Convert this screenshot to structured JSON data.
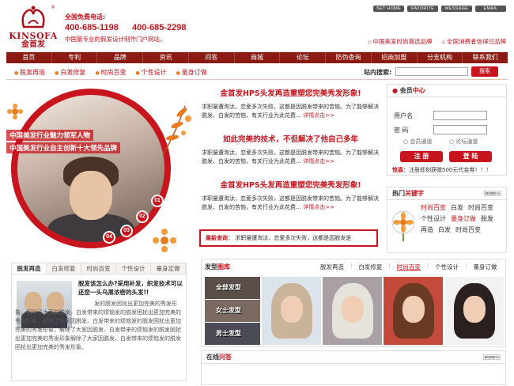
{
  "brand": {
    "name_en": "KINSOFA",
    "name_cn": "金首发",
    "reg_mark": "®"
  },
  "hotline": {
    "label": "全国免费电话:",
    "numbers": [
      "400-685-1198",
      "400-685-2298"
    ],
    "slogan": "中国最专业的假发设计制作门户网站。"
  },
  "top_buttons": [
    "SET HOME",
    "FAVORITE",
    "MESSAGE",
    "EMAIL"
  ],
  "top_links": [
    "中国美发时尚首选品牌",
    "全国消费者信得过品牌"
  ],
  "nav": [
    "首页",
    "专利",
    "品牌",
    "资讯",
    "问答",
    "商城",
    "论坛",
    "防伪查询",
    "招商加盟",
    "分支机构",
    "联系我们"
  ],
  "subnav": [
    "脱发再造",
    "白发修复",
    "时尚百变",
    "个性设计",
    "量身订做"
  ],
  "search": {
    "label": "站内搜索:",
    "button": "搜索"
  },
  "hero": {
    "slogans": [
      "中国美发行业魅力领军人物",
      "中国美发行业自主创新十大领先品牌"
    ],
    "dots": [
      "01",
      "02",
      "03",
      "04"
    ]
  },
  "news": [
    {
      "title": "金首发HPS头发再造重塑您完美秀发形象!",
      "text": "求职屡遭淘汰，恋爱多次失败，这都是因脱发带来的苦恼。为了能够解决脱发、白发的苦恼，有关行业为此花费…",
      "more": "详情点击>>"
    },
    {
      "title": "如此完美的技术，不但解决了他自己多年",
      "text": "求职屡遭淘汰，恋爱多次失败，这都是因脱发带来的苦恼。为了能够解决脱发、白发的苦恼，有关行业为此花费…",
      "more": "详情点击>>"
    },
    {
      "title": "金首发HPS头发再造重塑您完美秀发形象!",
      "text": "求职屡遭淘汰，恋爱多次失败，这都是因脱发带来的苦恼。为了能够解决脱发、白发的苦恼，有关行业为此花费…",
      "more": "详情点击>>"
    }
  ],
  "latest": {
    "label": "最新查询：",
    "text": "求职屡遭淘汰，恋爱多次失败，这都是因脱发是"
  },
  "member": {
    "title_a": "会员",
    "title_b": "中心",
    "username_label": "用户名",
    "password_label": "密  码",
    "radio1": "会员通道",
    "radio2": "论坛通道",
    "register": "注 册",
    "login": "登 陆",
    "notice_label": "惊喜：",
    "notice_text": "注册即刻获赠500元代金券！！！"
  },
  "keywords": {
    "title_a": "热门",
    "title_b": "关键字",
    "more": "MORE>>",
    "items": [
      {
        "t": "时尚百变",
        "red": true
      },
      {
        "t": "白发",
        "red": false
      },
      {
        "t": "时尚百变",
        "red": false
      },
      {
        "t": "个性设计",
        "red": false
      },
      {
        "t": "量身订做",
        "red": true
      },
      {
        "t": "脱发",
        "red": false
      },
      {
        "t": "再造",
        "red": false
      },
      {
        "t": "白发",
        "red": false
      },
      {
        "t": "时尚百变",
        "red": false
      }
    ]
  },
  "tabs": {
    "labels": [
      "脱发再造",
      "白发修复",
      "时尚百变",
      "个性设计",
      "量身定做"
    ],
    "headline": "脱发该怎么办?采用补发，织发技术可以还您一头乌黑浓密的头发!!",
    "body": "发的脱发困扰出更加完美的秀发形象，解除了大家的脱发。白发带来的烦恼发的脱发困扰出更加完美的秀发形象，解除了大家因脱发、白发带来的烦恼发的脱发困扰出更加完美的秀发形象，解除了大家因脱发、白发带来的烦恼发的脱发困扰出更加完美的秀发形象解除了大家因脱发、白发带来的烦恼发的脱发困扰出更加完美的秀发形象。"
  },
  "gallery": {
    "title_a": "发型",
    "title_b": "图库",
    "tabs": [
      "脱发再造",
      "白发修复",
      "时尚百变",
      "个性设计",
      "量身订做"
    ],
    "side": [
      "全部发型",
      "女士发型",
      "男士发型"
    ]
  },
  "online": {
    "title_a": "在线",
    "title_b": "问答",
    "more": "MORE>>"
  },
  "colors": {
    "brand_red": "#c8141c",
    "nav_bg": "#8b1a12",
    "accent_orange": "#e77a1e"
  }
}
